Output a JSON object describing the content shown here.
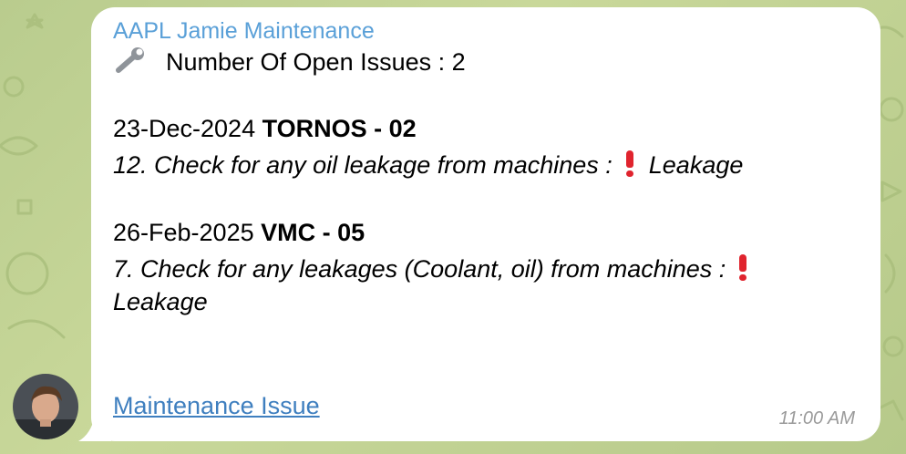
{
  "message": {
    "sender": "AAPL Jamie Maintenance",
    "header_icon": "wrench-icon",
    "header_text": "Number Of Open Issues : 2",
    "issues": [
      {
        "date": "23-Dec-2024",
        "machine": "TORNOS - 02",
        "check": "12. Check for any oil leakage from machines :",
        "alert_icon": "exclamation-icon",
        "status": "Leakage"
      },
      {
        "date": "26-Feb-2025",
        "machine": "VMC - 05",
        "check": "7. Check for any leakages (Coolant, oil) from machines :",
        "alert_icon": "exclamation-icon",
        "status": "Leakage"
      }
    ],
    "link_text": "Maintenance Issue",
    "time": "11:00 AM"
  },
  "colors": {
    "sender": "#5aa0d8",
    "link": "#3f7fbf",
    "alert": "#e0242e",
    "chat_background": "#c2d494",
    "bubble": "#ffffff",
    "timestamp": "#9a9a9a"
  }
}
